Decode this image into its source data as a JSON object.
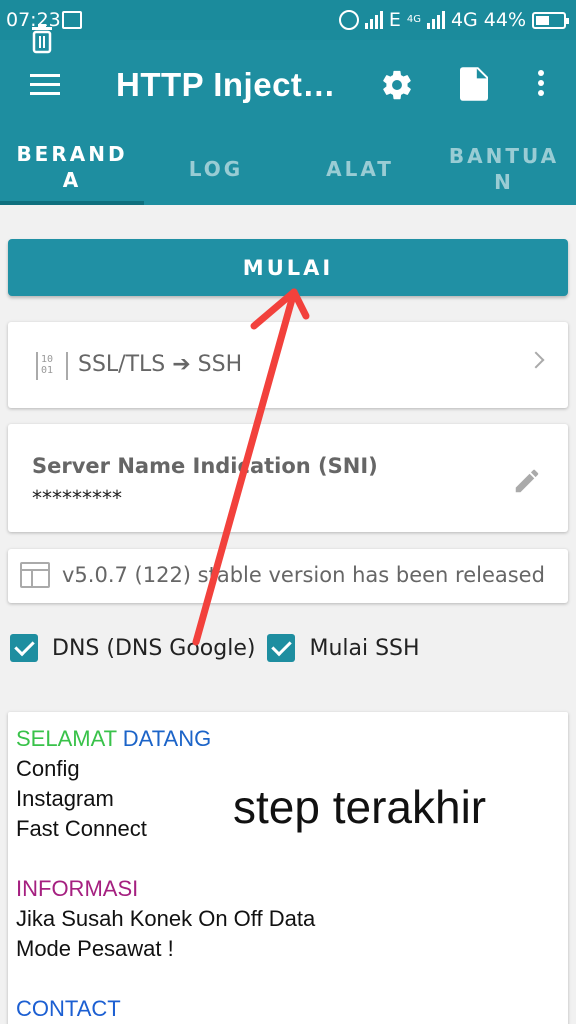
{
  "status_bar": {
    "time": "07:23",
    "network_1": "E",
    "network_2_tag": "4G",
    "network_2": "4G",
    "battery": "44%"
  },
  "app_bar": {
    "title": "HTTP Inject…",
    "icons": [
      "trash-icon",
      "menu-icon",
      "gear-icon",
      "document-icon",
      "more-vert-icon"
    ]
  },
  "tabs": [
    {
      "label": "BERANDA",
      "active": true
    },
    {
      "label": "LOG",
      "active": false
    },
    {
      "label": "ALAT",
      "active": false
    },
    {
      "label": "BANTUAN",
      "active": false
    }
  ],
  "start_button": {
    "label": "MULAI"
  },
  "mode": {
    "icon_text": "10\n01",
    "label": "SSL/TLS ➔ SSH"
  },
  "sni": {
    "title": "Server Name Indication (SNI)",
    "value": "*********"
  },
  "update": {
    "label": "v5.0.7 (122) stable version has been released"
  },
  "options": [
    {
      "label": "DNS (DNS Google)",
      "checked": true
    },
    {
      "label": "Mulai SSH",
      "checked": true
    }
  ],
  "info": {
    "welcome_1": "SELAMAT",
    "welcome_2": "DATANG",
    "config_lines": [
      "Config",
      "Instagram",
      "Fast Connect"
    ],
    "info_heading": "INFORMASI",
    "info_lines": [
      "Jika Susah Konek On Off Data",
      "Mode Pesawat !"
    ],
    "contact_heading": "CONTACT"
  },
  "annotation": {
    "text": "step terakhir",
    "arrow_color": "#f2413c"
  },
  "colors": {
    "primary": "#1e8ea0",
    "status_bar": "#1b8b9c",
    "background": "#f1f1f1"
  }
}
